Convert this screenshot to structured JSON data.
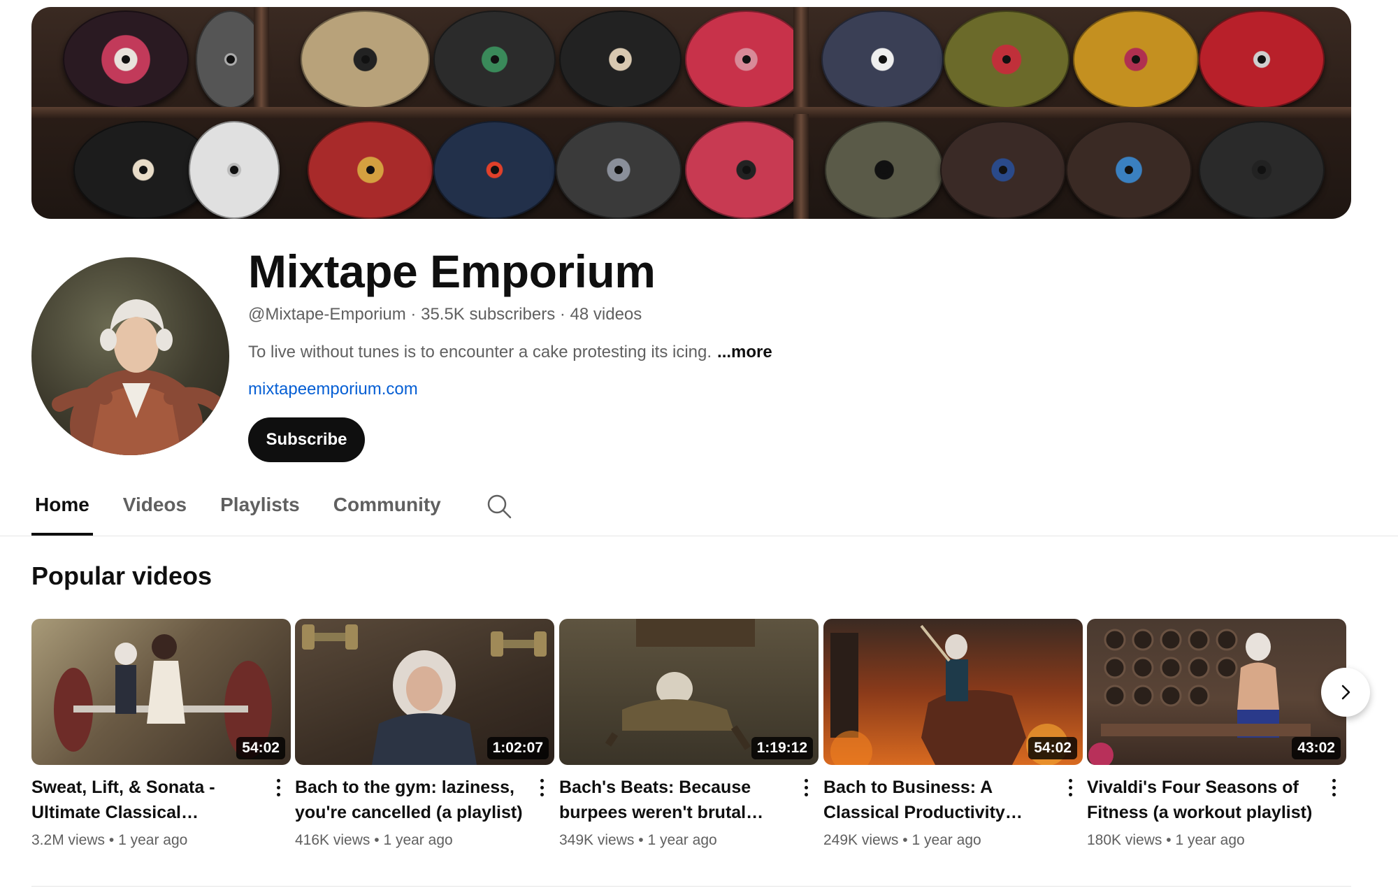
{
  "channel": {
    "name": "Mixtape Emporium",
    "handle": "@Mixtape-Emporium",
    "subscribers": "35.5K subscribers",
    "videos_count": "48 videos",
    "separator": "·",
    "description": "To live without tunes is to encounter a cake protesting its icing.",
    "more_label": "...more",
    "link": "mixtapeemporium.com",
    "subscribe_label": "Subscribe"
  },
  "tabs": [
    {
      "label": "Home",
      "active": true
    },
    {
      "label": "Videos",
      "active": false
    },
    {
      "label": "Playlists",
      "active": false
    },
    {
      "label": "Community",
      "active": false
    }
  ],
  "section": {
    "title": "Popular videos"
  },
  "videos": [
    {
      "title": "Sweat, Lift, & Sonata - Ultimate Classical Workout…",
      "duration": "54:02",
      "views": "3.2M views",
      "age": "1 year ago",
      "dot": "•"
    },
    {
      "title": "Bach to the gym: laziness, you're cancelled (a playlist)",
      "duration": "1:02:07",
      "views": "416K views",
      "age": "1 year ago",
      "dot": "•"
    },
    {
      "title": "Bach's Beats: Because burpees weren't brutal…",
      "duration": "1:19:12",
      "views": "349K views",
      "age": "1 year ago",
      "dot": "•"
    },
    {
      "title": "Bach to Business: A Classical Productivity Playlist",
      "duration": "54:02",
      "views": "249K views",
      "age": "1 year ago",
      "dot": "•"
    },
    {
      "title": "Vivaldi's Four Seasons of Fitness (a workout playlist)",
      "duration": "43:02",
      "views": "180K views",
      "age": "1 year ago",
      "dot": "•"
    }
  ],
  "icons": {
    "search": "search-icon",
    "next": "chevron-right-icon",
    "menu": "more-vert-icon"
  },
  "colors": {
    "link": "#065fd4",
    "primary_text": "#0f0f0f",
    "secondary_text": "#606060",
    "subscribe_bg": "#0f0f0f"
  }
}
